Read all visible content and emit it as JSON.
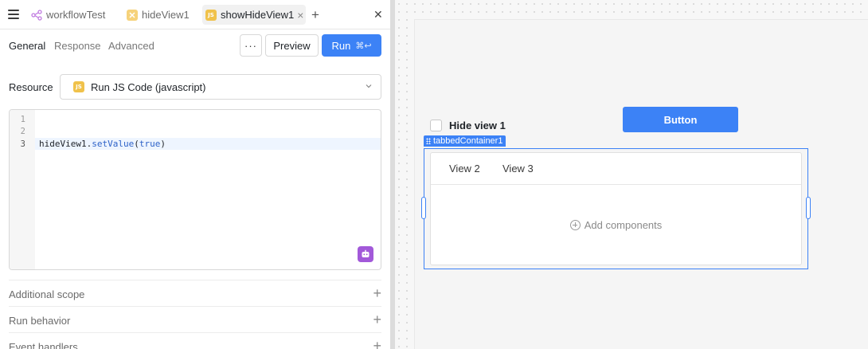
{
  "tabs": [
    {
      "label": "workflowTest",
      "icon": "workflow-icon"
    },
    {
      "label": "hideView1",
      "icon": "x-query-icon"
    },
    {
      "label": "showHideView1",
      "icon": "js-icon",
      "badge": "JS",
      "active": true
    }
  ],
  "subtabs": {
    "general": "General",
    "response": "Response",
    "advanced": "Advanced"
  },
  "toolbar": {
    "more": "···",
    "preview": "Preview",
    "run": "Run",
    "run_shortcut": "⌘↩"
  },
  "resource": {
    "label": "Resource",
    "badge": "JS",
    "value": "Run JS Code (javascript)"
  },
  "editor": {
    "line_numbers": [
      "1",
      "2",
      "3"
    ],
    "code": {
      "obj": "hideView1",
      "dot": ".",
      "method": "setValue",
      "open": "(",
      "arg": "true",
      "close": ")"
    }
  },
  "sections": {
    "additional_scope": "Additional scope",
    "run_behavior": "Run behavior",
    "event_handlers": "Event handlers"
  },
  "canvas": {
    "checkbox_label": "Hide view 1",
    "button_label": "Button",
    "selected_component": "tabbedContainer1",
    "view_tabs": [
      "View 2",
      "View 3"
    ],
    "add_components": "Add components"
  },
  "colors": {
    "accent": "#3c82f6",
    "js_badge": "#f0c24b",
    "ai_button": "#a259d9"
  }
}
